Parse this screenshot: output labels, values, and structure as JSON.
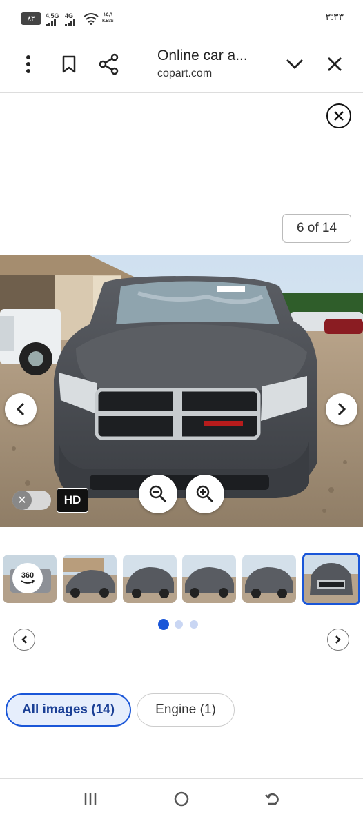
{
  "status_bar": {
    "battery": "٨٣",
    "network_1": "4.5G",
    "network_2": "4G",
    "speed_value": "١٥,٩",
    "speed_unit": "KB/S",
    "time": "٣:٣٣"
  },
  "browser": {
    "title": "Online car a...",
    "domain": "copart.com",
    "icons": [
      "more-vert-icon",
      "bookmark-icon",
      "share-icon",
      "chevron-down-icon",
      "close-icon"
    ]
  },
  "viewer": {
    "counter": "6 of 14",
    "hd_label": "HD",
    "toggle_mark": "✕"
  },
  "thumbnails": {
    "first_label": "360",
    "count_visible": 6,
    "selected_index": 5
  },
  "chips": {
    "all_images": "All images (14)",
    "engine": "Engine (1)"
  },
  "colors": {
    "accent": "#1a56d8",
    "chip_bg": "#e6eefc"
  }
}
